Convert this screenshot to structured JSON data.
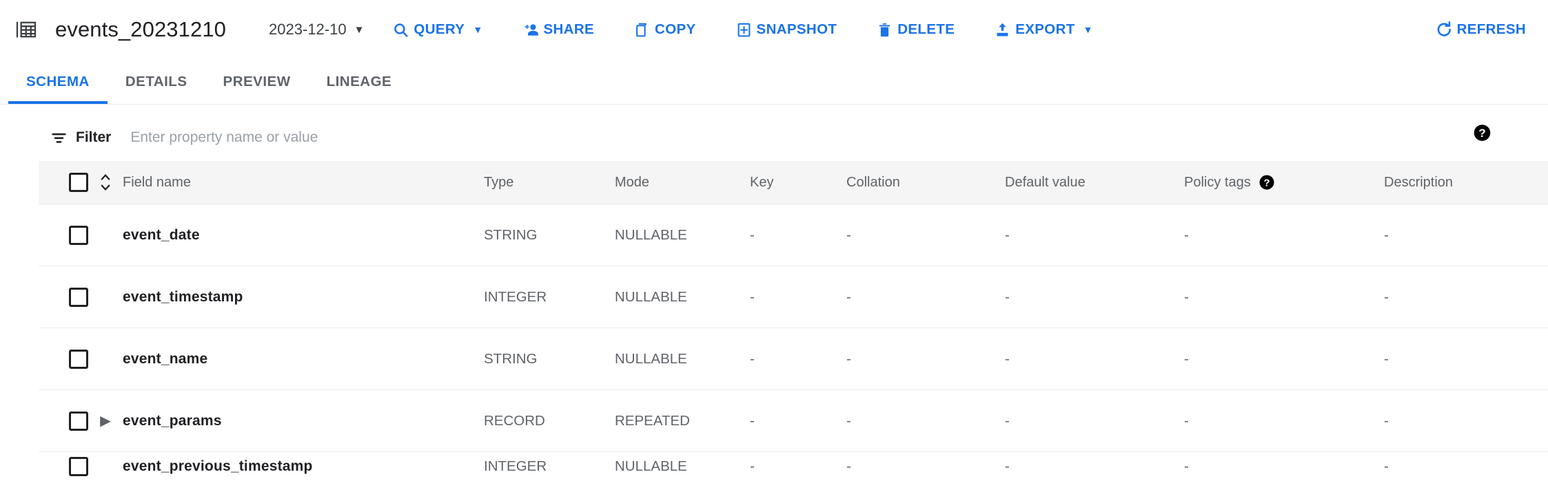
{
  "toolbar": {
    "table_icon": "table-grid-icon",
    "title": "events_20231210",
    "date_selector": {
      "label": "2023-12-10",
      "caret": "▼"
    },
    "actions": [
      {
        "id": "query",
        "label": "QUERY",
        "icon": "search-icon",
        "has_caret": true,
        "caret": "▼"
      },
      {
        "id": "share",
        "label": "SHARE",
        "icon": "person-add-icon",
        "has_caret": false,
        "caret": ""
      },
      {
        "id": "copy",
        "label": "COPY",
        "icon": "copy-icon",
        "has_caret": false,
        "caret": ""
      },
      {
        "id": "snapshot",
        "label": "SNAPSHOT",
        "icon": "snapshot-icon",
        "has_caret": false,
        "caret": ""
      },
      {
        "id": "delete",
        "label": "DELETE",
        "icon": "trash-icon",
        "has_caret": false,
        "caret": ""
      },
      {
        "id": "export",
        "label": "EXPORT",
        "icon": "upload-icon",
        "has_caret": true,
        "caret": "▼"
      }
    ],
    "refresh": {
      "label": "REFRESH",
      "icon": "refresh-icon"
    }
  },
  "tabs": [
    {
      "id": "schema",
      "label": "SCHEMA",
      "active": true
    },
    {
      "id": "details",
      "label": "DETAILS",
      "active": false
    },
    {
      "id": "preview",
      "label": "PREVIEW",
      "active": false
    },
    {
      "id": "lineage",
      "label": "LINEAGE",
      "active": false
    }
  ],
  "filter": {
    "icon": "filter-list-icon",
    "label": "Filter",
    "placeholder": "Enter property name or value",
    "value": "",
    "help_icon": "help-icon"
  },
  "schema_table": {
    "select_all_checkbox": false,
    "sort_icon": "sort-updown-icon",
    "columns": [
      {
        "id": "field_name",
        "label": "Field name"
      },
      {
        "id": "type",
        "label": "Type"
      },
      {
        "id": "mode",
        "label": "Mode"
      },
      {
        "id": "key",
        "label": "Key"
      },
      {
        "id": "collation",
        "label": "Collation"
      },
      {
        "id": "default_value",
        "label": "Default value"
      },
      {
        "id": "policy_tags",
        "label": "Policy tags",
        "help_icon": "help-icon"
      },
      {
        "id": "description",
        "label": "Description"
      }
    ],
    "rows": [
      {
        "name": "event_date",
        "type": "STRING",
        "mode": "NULLABLE",
        "key": "-",
        "collation": "-",
        "default_value": "-",
        "policy_tags": "-",
        "description": "-",
        "expandable": false,
        "expander": ""
      },
      {
        "name": "event_timestamp",
        "type": "INTEGER",
        "mode": "NULLABLE",
        "key": "-",
        "collation": "-",
        "default_value": "-",
        "policy_tags": "-",
        "description": "-",
        "expandable": false,
        "expander": ""
      },
      {
        "name": "event_name",
        "type": "STRING",
        "mode": "NULLABLE",
        "key": "-",
        "collation": "-",
        "default_value": "-",
        "policy_tags": "-",
        "description": "-",
        "expandable": false,
        "expander": ""
      },
      {
        "name": "event_params",
        "type": "RECORD",
        "mode": "REPEATED",
        "key": "-",
        "collation": "-",
        "default_value": "-",
        "policy_tags": "-",
        "description": "-",
        "expandable": true,
        "expander": "▶"
      },
      {
        "name": "event_previous_timestamp",
        "type": "INTEGER",
        "mode": "NULLABLE",
        "key": "-",
        "collation": "-",
        "default_value": "-",
        "policy_tags": "-",
        "description": "-",
        "expandable": false,
        "expander": "",
        "clipped": true
      }
    ]
  },
  "colors": {
    "accent_blue": "#1a73e8",
    "text_primary": "#202124",
    "text_secondary": "#5f6368",
    "header_bg": "#f5f5f5",
    "divider": "#e8eaed"
  }
}
